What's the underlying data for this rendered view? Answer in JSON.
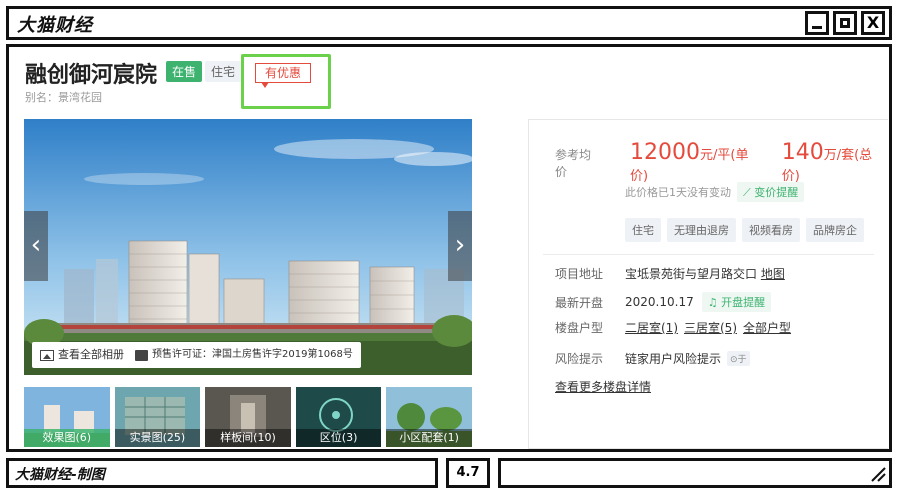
{
  "window": {
    "title": "大猫财经",
    "close_label": "X"
  },
  "project": {
    "name": "融创御河宸院",
    "status_tag": "在售",
    "type_tag": "住宅",
    "promo_tag": "有优惠",
    "alias": "别名：景湾花园"
  },
  "gallery": {
    "album_label": "查看全部相册",
    "permit_label": "预售许可证：津国土房售许字2019第1068号",
    "thumbs": [
      {
        "label": "效果图(6)"
      },
      {
        "label": "实景图(25)"
      },
      {
        "label": "样板间(10)"
      },
      {
        "label": "区位(3)"
      },
      {
        "label": "小区配套(1)"
      }
    ]
  },
  "price": {
    "label": "参考均价",
    "unit_price": "12000",
    "unit_price_suffix": "元/平(单价)",
    "total_price": "140",
    "total_price_suffix": "万/套(总价)",
    "no_change_text": "此价格已1天没有变动",
    "alert_label": "变价提醒"
  },
  "features": [
    "住宅",
    "无理由退房",
    "视频看房",
    "品牌房企"
  ],
  "attributes": {
    "address_key": "项目地址",
    "address_value": "宝坻景苑街与望月路交口",
    "map_link": "地图",
    "opening_key": "最新开盘",
    "opening_value": "2020.10.17",
    "opening_alert": "开盘提醒",
    "layout_key": "楼盘户型",
    "layout_1": "二居室(1)",
    "layout_2": "三居室(5)",
    "layout_all": "全部户型",
    "risk_key": "风险提示",
    "risk_value": "链家用户风险提示",
    "risk_badge": "⊙于"
  },
  "more_link": "查看更多楼盘详情",
  "footer": {
    "left_label": "大猫财经-制图",
    "rating": "4.7"
  }
}
